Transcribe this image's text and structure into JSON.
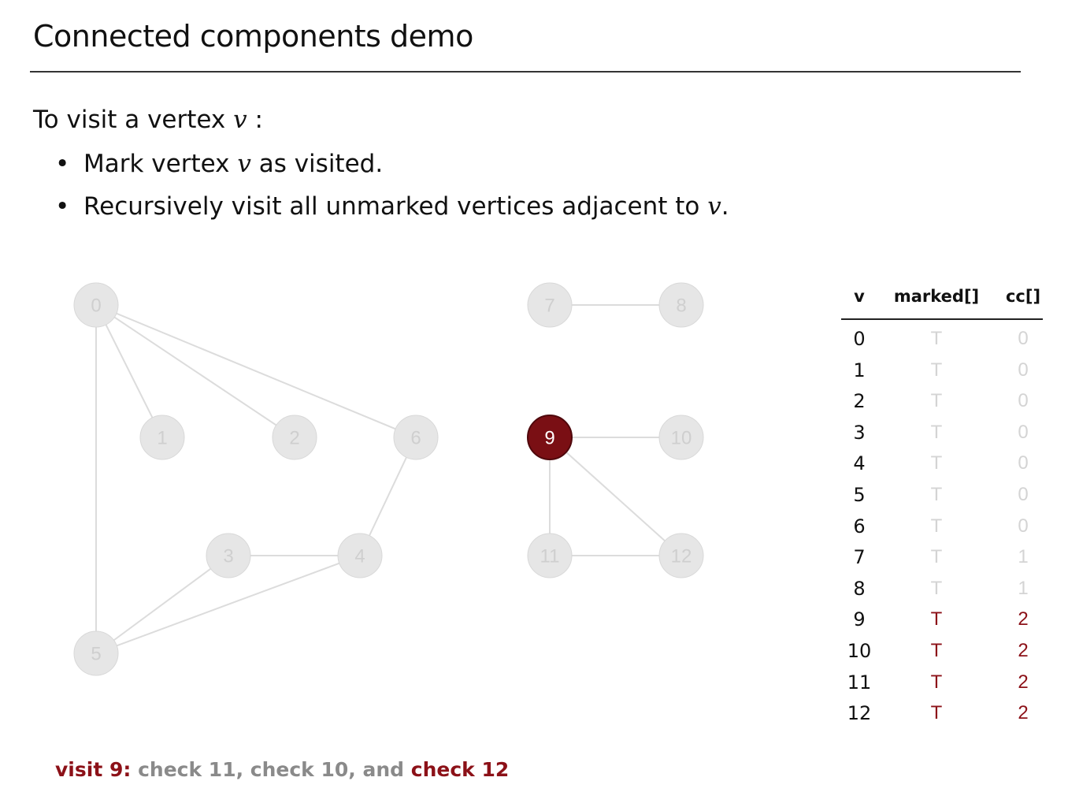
{
  "slide": {
    "title": "Connected components demo",
    "intro_prefix": "To visit a vertex ",
    "intro_var": "v",
    "intro_suffix": " :",
    "bullets": [
      {
        "before": "Mark vertex ",
        "var": "v",
        "after": " as visited."
      },
      {
        "before": "Recursively visit all unmarked vertices adjacent to ",
        "var": "v",
        "after": "."
      }
    ],
    "bullet_glyph": "•"
  },
  "graph": {
    "vertices": [
      {
        "id": "0",
        "state": "done"
      },
      {
        "id": "1",
        "state": "done"
      },
      {
        "id": "2",
        "state": "done"
      },
      {
        "id": "3",
        "state": "done"
      },
      {
        "id": "4",
        "state": "done"
      },
      {
        "id": "5",
        "state": "done"
      },
      {
        "id": "6",
        "state": "done"
      },
      {
        "id": "7",
        "state": "done"
      },
      {
        "id": "8",
        "state": "done"
      },
      {
        "id": "9",
        "state": "active"
      },
      {
        "id": "10",
        "state": "done"
      },
      {
        "id": "11",
        "state": "done"
      },
      {
        "id": "12",
        "state": "done"
      }
    ],
    "edges": [
      [
        "0",
        "1"
      ],
      [
        "0",
        "2"
      ],
      [
        "0",
        "6"
      ],
      [
        "0",
        "5"
      ],
      [
        "6",
        "4"
      ],
      [
        "3",
        "4"
      ],
      [
        "3",
        "5"
      ],
      [
        "4",
        "5"
      ],
      [
        "7",
        "8"
      ],
      [
        "9",
        "10"
      ],
      [
        "9",
        "11"
      ],
      [
        "9",
        "12"
      ],
      [
        "11",
        "12"
      ]
    ],
    "colors": {
      "active": "#7a0f14",
      "inactive": "#e6e6e6",
      "edge": "#dcdcdc"
    }
  },
  "table": {
    "headers": {
      "v": "v",
      "marked": "marked[]",
      "cc": "cc[]"
    },
    "rows": [
      {
        "v": "0",
        "marked": "T",
        "cc": "0",
        "hot": false
      },
      {
        "v": "1",
        "marked": "T",
        "cc": "0",
        "hot": false
      },
      {
        "v": "2",
        "marked": "T",
        "cc": "0",
        "hot": false
      },
      {
        "v": "3",
        "marked": "T",
        "cc": "0",
        "hot": false
      },
      {
        "v": "4",
        "marked": "T",
        "cc": "0",
        "hot": false
      },
      {
        "v": "5",
        "marked": "T",
        "cc": "0",
        "hot": false
      },
      {
        "v": "6",
        "marked": "T",
        "cc": "0",
        "hot": false
      },
      {
        "v": "7",
        "marked": "T",
        "cc": "1",
        "hot": false
      },
      {
        "v": "8",
        "marked": "T",
        "cc": "1",
        "hot": false
      },
      {
        "v": "9",
        "marked": "T",
        "cc": "2",
        "hot": true
      },
      {
        "v": "10",
        "marked": "T",
        "cc": "2",
        "hot": true
      },
      {
        "v": "11",
        "marked": "T",
        "cc": "2",
        "hot": true
      },
      {
        "v": "12",
        "marked": "T",
        "cc": "2",
        "hot": true
      }
    ],
    "hot_color": "#8c1118"
  },
  "status": {
    "visit": "visit 9:",
    "rest": " check 11, check 10, and ",
    "last": "check 12"
  }
}
